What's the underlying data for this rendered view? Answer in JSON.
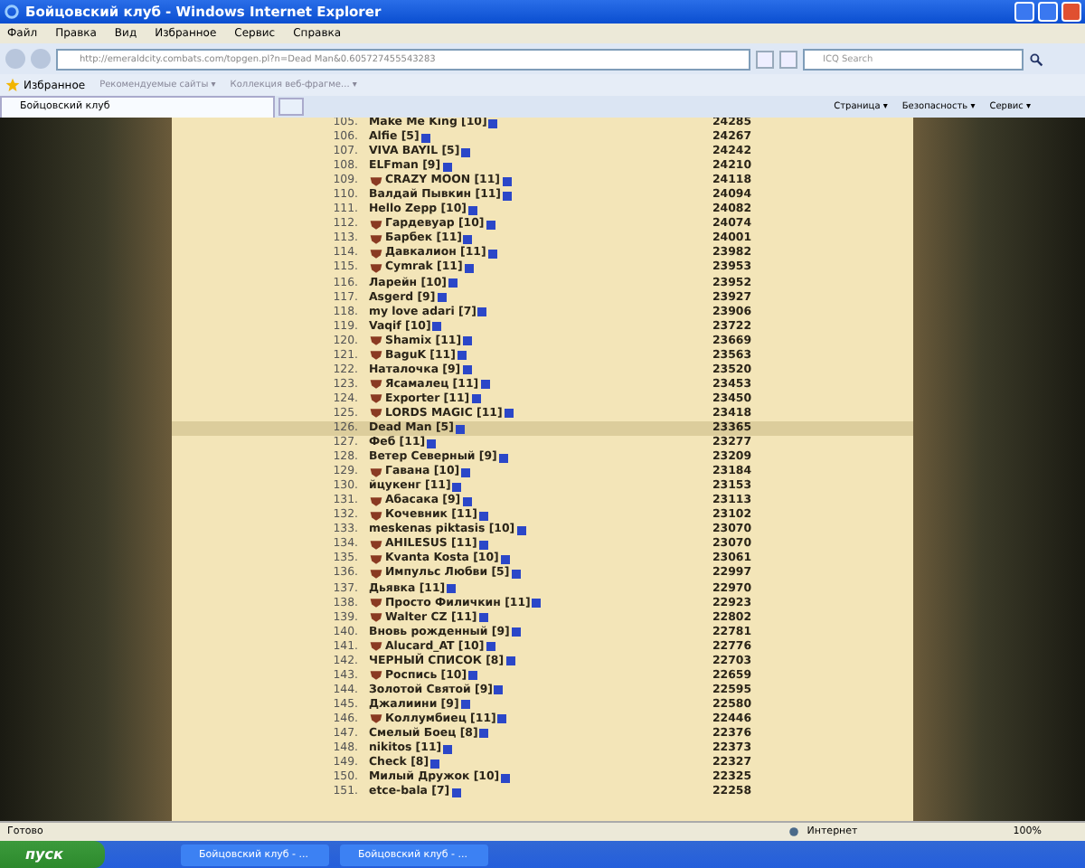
{
  "window": {
    "title": "Бойцовский клуб - Windows Internet Explorer"
  },
  "menu": [
    "Файл",
    "Правка",
    "Вид",
    "Избранное",
    "Сервис",
    "Справка"
  ],
  "address": {
    "value": "http://emeraldcity.combats.com/topgen.pl?n=Dead Man&0.605727455543283"
  },
  "search": {
    "placeholder": "ICQ Search"
  },
  "favorites": {
    "label": "Избранное",
    "links": [
      "Рекомендуемые сайты ▾",
      "Коллекция веб-фрагме... ▾"
    ]
  },
  "tab": {
    "label": "Бойцовский клуб"
  },
  "commands": [
    "Страница ▾",
    "Безопасность ▾",
    "Сервис ▾"
  ],
  "rows": [
    {
      "num": "105.",
      "name": "Make Me King [10]",
      "score": "24285",
      "emblem": false,
      "selected": false
    },
    {
      "num": "106.",
      "name": "Alfie [5]",
      "score": "24267",
      "emblem": false,
      "selected": false
    },
    {
      "num": "107.",
      "name": "VIVA BAYIL [5]",
      "score": "24242",
      "emblem": false,
      "selected": false
    },
    {
      "num": "108.",
      "name": "ELFman [9]",
      "score": "24210",
      "emblem": false,
      "selected": false
    },
    {
      "num": "109.",
      "name": "CRAZY MOON [11]",
      "score": "24118",
      "emblem": true,
      "selected": false
    },
    {
      "num": "110.",
      "name": "Валдай Пывкин [11]",
      "score": "24094",
      "emblem": false,
      "selected": false
    },
    {
      "num": "111.",
      "name": "Hello Zepp [10]",
      "score": "24082",
      "emblem": false,
      "selected": false
    },
    {
      "num": "112.",
      "name": "Гардевуар [10]",
      "score": "24074",
      "emblem": true,
      "selected": false
    },
    {
      "num": "113.",
      "name": "Барбек [11]",
      "score": "24001",
      "emblem": true,
      "selected": false
    },
    {
      "num": "114.",
      "name": "Давкалион [11]",
      "score": "23982",
      "emblem": true,
      "selected": false
    },
    {
      "num": "115.",
      "name": "Cymrak [11]",
      "score": "23953",
      "emblem": true,
      "selected": false
    },
    {
      "num": "116.",
      "name": "Ларейн [10]",
      "score": "23952",
      "emblem": false,
      "selected": false
    },
    {
      "num": "117.",
      "name": "Asgerd [9]",
      "score": "23927",
      "emblem": false,
      "selected": false
    },
    {
      "num": "118.",
      "name": "my love adari [7]",
      "score": "23906",
      "emblem": false,
      "selected": false
    },
    {
      "num": "119.",
      "name": "Vaqif [10]",
      "score": "23722",
      "emblem": false,
      "selected": false
    },
    {
      "num": "120.",
      "name": "Shamix [11]",
      "score": "23669",
      "emblem": true,
      "selected": false
    },
    {
      "num": "121.",
      "name": "BaguK [11]",
      "score": "23563",
      "emblem": true,
      "selected": false
    },
    {
      "num": "122.",
      "name": "Наталочка [9]",
      "score": "23520",
      "emblem": false,
      "selected": false
    },
    {
      "num": "123.",
      "name": "Ясамалец [11]",
      "score": "23453",
      "emblem": true,
      "selected": false
    },
    {
      "num": "124.",
      "name": "Exporter [11]",
      "score": "23450",
      "emblem": true,
      "selected": false
    },
    {
      "num": "125.",
      "name": "LORDS MAGIC [11]",
      "score": "23418",
      "emblem": true,
      "selected": false
    },
    {
      "num": "126.",
      "name": "Dead Man [5]",
      "score": "23365",
      "emblem": false,
      "selected": true
    },
    {
      "num": "127.",
      "name": "Феб [11]",
      "score": "23277",
      "emblem": false,
      "selected": false
    },
    {
      "num": "128.",
      "name": "Ветер Северный [9]",
      "score": "23209",
      "emblem": false,
      "selected": false
    },
    {
      "num": "129.",
      "name": "Гавана [10]",
      "score": "23184",
      "emblem": true,
      "selected": false
    },
    {
      "num": "130.",
      "name": "йцукенг [11]",
      "score": "23153",
      "emblem": false,
      "selected": false
    },
    {
      "num": "131.",
      "name": "Абасака [9]",
      "score": "23113",
      "emblem": true,
      "selected": false
    },
    {
      "num": "132.",
      "name": "Кочевник [11]",
      "score": "23102",
      "emblem": true,
      "selected": false
    },
    {
      "num": "133.",
      "name": "meskenas piktasis [10]",
      "score": "23070",
      "emblem": false,
      "selected": false
    },
    {
      "num": "134.",
      "name": "AHILESUS [11]",
      "score": "23070",
      "emblem": true,
      "selected": false
    },
    {
      "num": "135.",
      "name": "Kvanta Kosta [10]",
      "score": "23061",
      "emblem": true,
      "selected": false
    },
    {
      "num": "136.",
      "name": "Импульс Любви [5]",
      "score": "22997",
      "emblem": true,
      "selected": false
    },
    {
      "num": "137.",
      "name": "Дьявка [11]",
      "score": "22970",
      "emblem": false,
      "selected": false
    },
    {
      "num": "138.",
      "name": "Просто Филичкин [11]",
      "score": "22923",
      "emblem": true,
      "selected": false
    },
    {
      "num": "139.",
      "name": "Walter CZ [11]",
      "score": "22802",
      "emblem": true,
      "selected": false
    },
    {
      "num": "140.",
      "name": "Вновь рожденный [9]",
      "score": "22781",
      "emblem": false,
      "selected": false
    },
    {
      "num": "141.",
      "name": "Alucard_AT [10]",
      "score": "22776",
      "emblem": true,
      "selected": false
    },
    {
      "num": "142.",
      "name": "ЧЕРНЫЙ СПИСОК [8]",
      "score": "22703",
      "emblem": false,
      "selected": false
    },
    {
      "num": "143.",
      "name": "Роспись [10]",
      "score": "22659",
      "emblem": true,
      "selected": false
    },
    {
      "num": "144.",
      "name": "Золотой Святой [9]",
      "score": "22595",
      "emblem": false,
      "selected": false
    },
    {
      "num": "145.",
      "name": "Джалиини [9]",
      "score": "22580",
      "emblem": false,
      "selected": false
    },
    {
      "num": "146.",
      "name": "Коллумбиец [11]",
      "score": "22446",
      "emblem": true,
      "selected": false
    },
    {
      "num": "147.",
      "name": "Смелый Боец [8]",
      "score": "22376",
      "emblem": false,
      "selected": false
    },
    {
      "num": "148.",
      "name": "nikitos [11]",
      "score": "22373",
      "emblem": false,
      "selected": false
    },
    {
      "num": "149.",
      "name": "Check [8]",
      "score": "22327",
      "emblem": false,
      "selected": false
    },
    {
      "num": "150.",
      "name": "Милый Дружок [10]",
      "score": "22325",
      "emblem": false,
      "selected": false
    },
    {
      "num": "151.",
      "name": "etce-bala [7]",
      "score": "22258",
      "emblem": false,
      "selected": false
    }
  ],
  "status_bar": {
    "text": "Готово",
    "zone": "Интернет",
    "zoom": "100%"
  },
  "taskbar": {
    "start": "пуск",
    "tasks": [
      "Бойцовский клуб - ...",
      "Бойцовский клуб - ..."
    ]
  }
}
